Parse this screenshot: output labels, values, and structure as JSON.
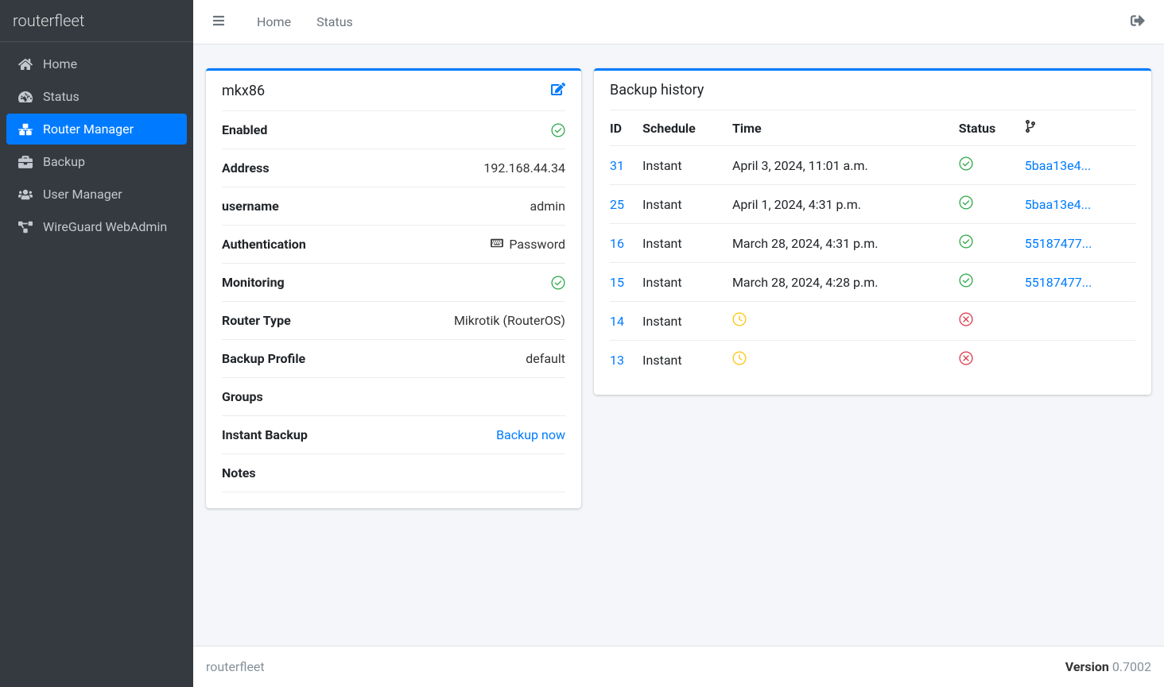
{
  "brand": "routerfleet",
  "sidebar": {
    "items": [
      {
        "label": "Home"
      },
      {
        "label": "Status"
      },
      {
        "label": "Router Manager"
      },
      {
        "label": "Backup"
      },
      {
        "label": "User Manager"
      },
      {
        "label": "WireGuard WebAdmin"
      }
    ]
  },
  "topnav": {
    "home": "Home",
    "status": "Status"
  },
  "router": {
    "name": "mkx86",
    "fields": {
      "enabled_label": "Enabled",
      "address_label": "Address",
      "address_value": "192.168.44.34",
      "username_label": "username",
      "username_value": "admin",
      "auth_label": "Authentication",
      "auth_value": "Password",
      "monitoring_label": "Monitoring",
      "routertype_label": "Router Type",
      "routertype_value": "Mikrotik (RouterOS)",
      "profile_label": "Backup Profile",
      "profile_value": "default",
      "groups_label": "Groups",
      "instant_label": "Instant Backup",
      "instant_action": "Backup now",
      "notes_label": "Notes"
    }
  },
  "history": {
    "title": "Backup history",
    "headers": {
      "id": "ID",
      "schedule": "Schedule",
      "time": "Time",
      "status": "Status"
    },
    "rows": [
      {
        "id": "31",
        "schedule": "Instant",
        "time": "April 3, 2024, 11:01 a.m.",
        "status": "success",
        "hash": "5baa13e4..."
      },
      {
        "id": "25",
        "schedule": "Instant",
        "time": "April 1, 2024, 4:31 p.m.",
        "status": "success",
        "hash": "5baa13e4..."
      },
      {
        "id": "16",
        "schedule": "Instant",
        "time": "March 28, 2024, 4:31 p.m.",
        "status": "success",
        "hash": "55187477..."
      },
      {
        "id": "15",
        "schedule": "Instant",
        "time": "March 28, 2024, 4:28 p.m.",
        "status": "success",
        "hash": "55187477..."
      },
      {
        "id": "14",
        "schedule": "Instant",
        "time": "",
        "status": "pending_error",
        "hash": ""
      },
      {
        "id": "13",
        "schedule": "Instant",
        "time": "",
        "status": "pending_error",
        "hash": ""
      }
    ]
  },
  "footer": {
    "left": "routerfleet",
    "version_label": "Version",
    "version_value": " 0.7002"
  }
}
